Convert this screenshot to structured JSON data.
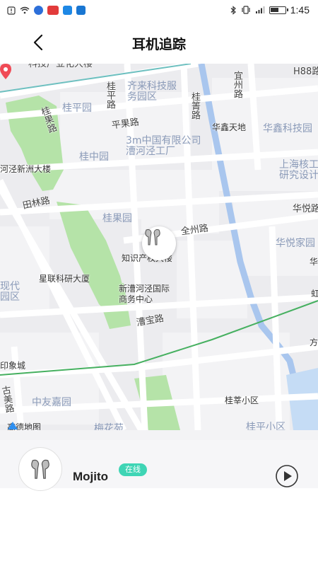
{
  "status_bar": {
    "time": "1:45",
    "icons": [
      "notification-icon",
      "wifi-icon",
      "app-icon",
      "app-icon",
      "app-icon",
      "app-icon"
    ],
    "right_icons": [
      "bluetooth-icon",
      "vibrate-icon",
      "signal-icon",
      "battery-icon"
    ]
  },
  "header": {
    "title": "耳机追踪"
  },
  "map": {
    "roads": {
      "r1": "科技广业化大楼",
      "r2": "桂果路",
      "r3": "桂平路",
      "r4": "平果路",
      "r5": "桂箐路",
      "r6": "宜州路",
      "r7": "田林路",
      "r8": "全州路",
      "r9": "华悦路",
      "r10": "漕宝路",
      "r11": "古美路",
      "r12": "H88路"
    },
    "areas": {
      "a1": "桂平园",
      "a2": "齐来科技服务园区",
      "a3": "华鑫天地",
      "a4": "华鑫科技园",
      "a5": "3m中国有限公司漕河泾工厂",
      "a6": "桂中园",
      "a7": "上海核工研究设计",
      "a8": "河泾新洲大楼",
      "a9": "桂果园",
      "a10": "华悦家园",
      "a11": "现代园区",
      "a12": "中友嘉园",
      "a13": "桂平小区",
      "a14": "梅花苑"
    },
    "pois": {
      "p1": "知识产权大楼",
      "p2": "星联科研大厦",
      "p3": "新漕河泾国际商务中心",
      "p4": "桂莘小区",
      "p5": "印象城",
      "p6": "华",
      "p7": "方",
      "p8": "虹"
    },
    "attribution": "高德地图"
  },
  "device": {
    "name": "Mojito",
    "status": "在线"
  },
  "colors": {
    "badge": "#3fd5b5",
    "green_area": "#b5e3a8",
    "river": "#a9c6ee"
  }
}
